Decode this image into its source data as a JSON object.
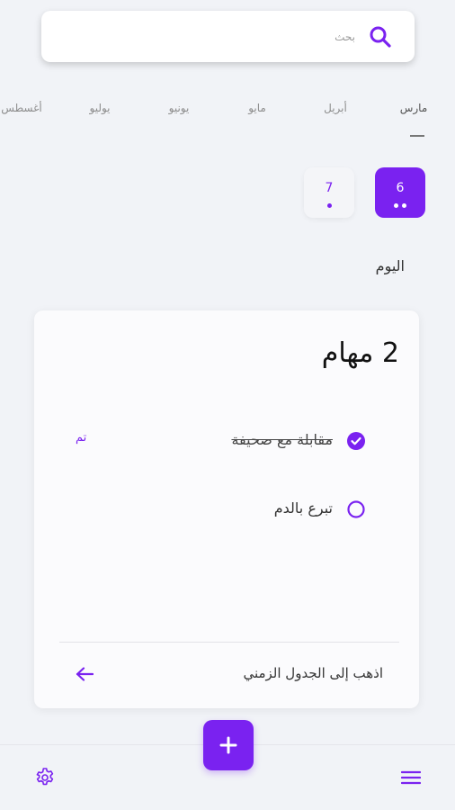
{
  "search": {
    "placeholder": "بحث",
    "icon": "search-icon"
  },
  "months": [
    {
      "label": "مارس",
      "active": true
    },
    {
      "label": "أبريل",
      "active": false
    },
    {
      "label": "مايو",
      "active": false
    },
    {
      "label": "يونيو",
      "active": false
    },
    {
      "label": "يوليو",
      "active": false
    },
    {
      "label": "أغسطس",
      "active": false
    }
  ],
  "days": [
    {
      "number": "6",
      "dots": 2,
      "selected": true
    },
    {
      "number": "7",
      "dots": 1,
      "selected": false
    }
  ],
  "section_title": "اليوم",
  "card": {
    "title": "2 مهام",
    "tasks": [
      {
        "label": "مقابلة مع صحيفة",
        "done": true,
        "status": "تم"
      },
      {
        "label": "تبرع بالدم",
        "done": false,
        "status": ""
      }
    ],
    "timeline_link": "اذهب إلى الجدول الزمني"
  },
  "bottom_bar": {
    "add_icon": "plus-icon",
    "settings_icon": "gear-icon",
    "menu_icon": "menu-icon"
  },
  "colors": {
    "accent": "#7a22f0",
    "background": "#f1f3f7",
    "card": "#fbfbfd"
  }
}
